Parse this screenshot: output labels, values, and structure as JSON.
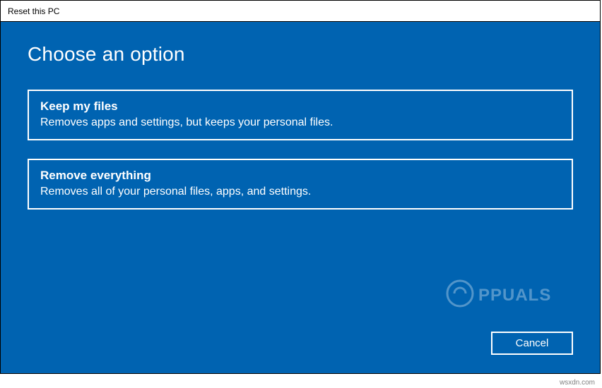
{
  "window": {
    "title": "Reset this PC"
  },
  "heading": "Choose an option",
  "options": [
    {
      "title": "Keep my files",
      "description": "Removes apps and settings, but keeps your personal files."
    },
    {
      "title": "Remove everything",
      "description": "Removes all of your personal files, apps, and settings."
    }
  ],
  "cancel_label": "Cancel",
  "watermark_text": "APPUALS",
  "site_credit": "wsxdn.com",
  "colors": {
    "accent": "#0063B1",
    "text_light": "#ffffff"
  }
}
